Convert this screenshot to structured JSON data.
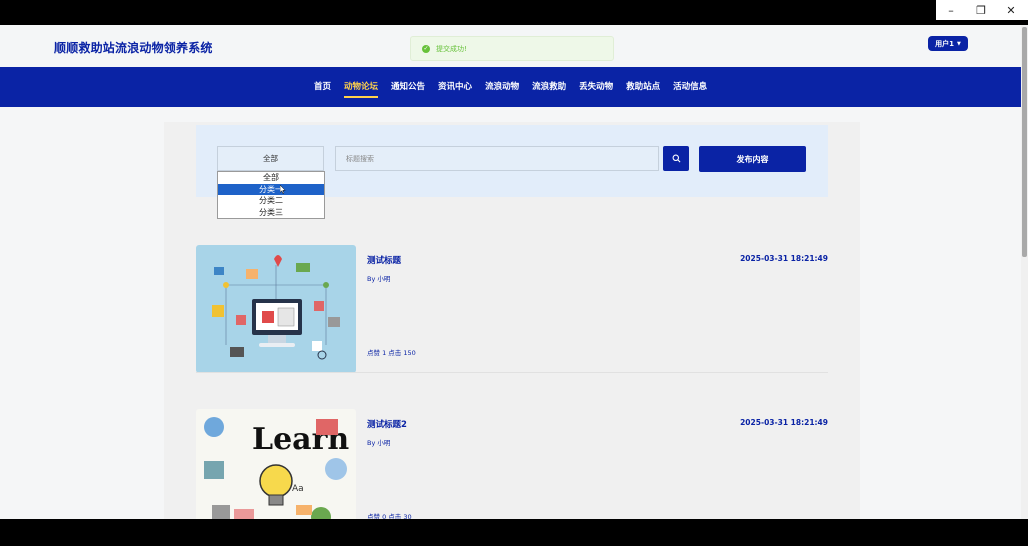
{
  "window": {
    "minimize": "–",
    "restore": "❐",
    "close": "✕"
  },
  "header": {
    "site_title": "顺顺救助站流浪动物领养系统",
    "toast_text": "提交成功!",
    "user_label": "用户1"
  },
  "nav": {
    "items": [
      {
        "label": "首页",
        "active": false
      },
      {
        "label": "动物论坛",
        "active": true
      },
      {
        "label": "通知公告",
        "active": false
      },
      {
        "label": "资讯中心",
        "active": false
      },
      {
        "label": "流浪动物",
        "active": false
      },
      {
        "label": "流浪救助",
        "active": false
      },
      {
        "label": "丢失动物",
        "active": false
      },
      {
        "label": "救助站点",
        "active": false
      },
      {
        "label": "活动信息",
        "active": false
      }
    ]
  },
  "search": {
    "category_value": "全部",
    "placeholder": "标题搜索",
    "publish_label": "发布内容",
    "options": [
      "全部",
      "分类一",
      "分类二",
      "分类三"
    ],
    "selected_option": "分类一"
  },
  "posts": [
    {
      "title": "测试标题",
      "author": "By 小明",
      "stats": "点赞 1  点击 150",
      "date": "2025-03-31 18:21:49"
    },
    {
      "title": "测试标题2",
      "author": "By 小明",
      "stats": "点赞 0  点击 30",
      "date": "2025-03-31 18:21:49"
    }
  ],
  "colors": {
    "brand": "#0a23a5",
    "nav_active": "#ffd24c",
    "success": "#67c23a"
  }
}
